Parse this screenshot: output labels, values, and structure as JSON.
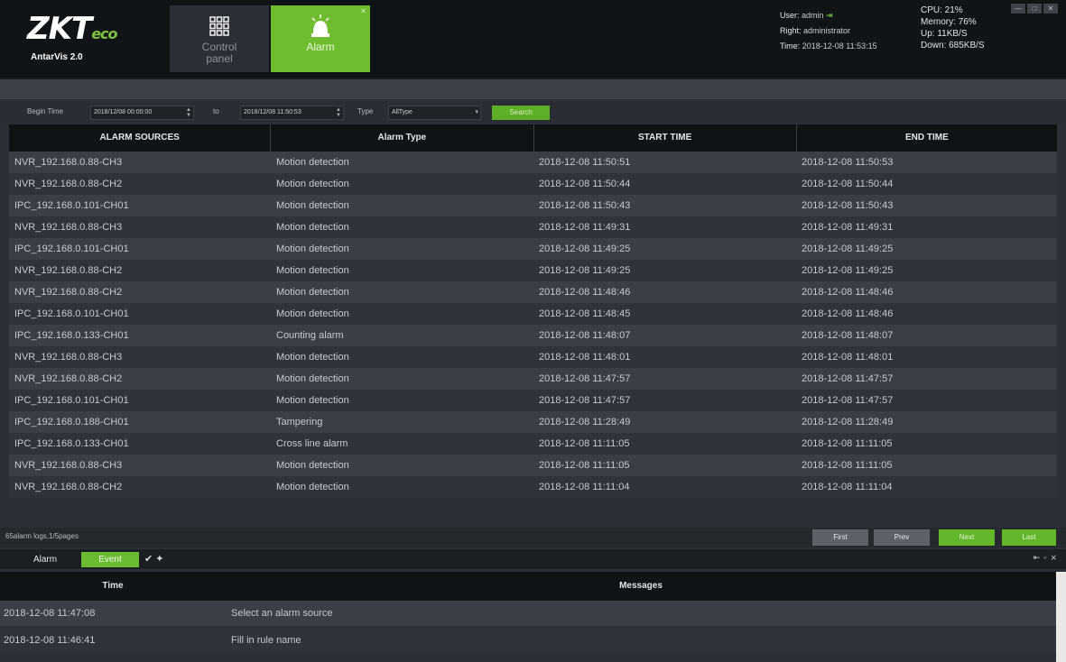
{
  "header": {
    "logo_text": "ZKT",
    "logo_suffix": "eco",
    "version": "AntarVis 2.0",
    "control_panel_label": "Control panel",
    "alarm_label": "Alarm",
    "user_label": "User:",
    "user_value": "admin",
    "right_label": "Right:",
    "right_value": "administrator",
    "time_label": "Time:",
    "time_value": "2018-12-08 11:53:15",
    "cpu": "CPU: 21%",
    "memory": "Memory: 76%",
    "up": "Up: 11KB/S",
    "down": "Down: 685KB/S"
  },
  "filter": {
    "begin_label": "Begin Time",
    "begin_value": "2018/12/08 00:00:00",
    "to_label": "to",
    "end_value": "2018/12/08 11:50:53",
    "type_label": "Type",
    "type_value": "AllType",
    "search_label": "Search"
  },
  "table": {
    "headers": [
      "ALARM SOURCES",
      "Alarm Type",
      "START TIME",
      "END TIME"
    ],
    "rows": [
      [
        "NVR_192.168.0.88-CH3",
        "Motion detection",
        "2018-12-08 11:50:51",
        "2018-12-08 11:50:53"
      ],
      [
        "NVR_192.168.0.88-CH2",
        "Motion detection",
        "2018-12-08 11:50:44",
        "2018-12-08 11:50:44"
      ],
      [
        "IPC_192.168.0.101-CH01",
        "Motion detection",
        "2018-12-08 11:50:43",
        "2018-12-08 11:50:43"
      ],
      [
        "NVR_192.168.0.88-CH3",
        "Motion detection",
        "2018-12-08 11:49:31",
        "2018-12-08 11:49:31"
      ],
      [
        "IPC_192.168.0.101-CH01",
        "Motion detection",
        "2018-12-08 11:49:25",
        "2018-12-08 11:49:25"
      ],
      [
        "NVR_192.168.0.88-CH2",
        "Motion detection",
        "2018-12-08 11:49:25",
        "2018-12-08 11:49:25"
      ],
      [
        "NVR_192.168.0.88-CH2",
        "Motion detection",
        "2018-12-08 11:48:46",
        "2018-12-08 11:48:46"
      ],
      [
        "IPC_192.168.0.101-CH01",
        "Motion detection",
        "2018-12-08 11:48:45",
        "2018-12-08 11:48:46"
      ],
      [
        "IPC_192.168.0.133-CH01",
        "Counting alarm",
        "2018-12-08 11:48:07",
        "2018-12-08 11:48:07"
      ],
      [
        "NVR_192.168.0.88-CH3",
        "Motion detection",
        "2018-12-08 11:48:01",
        "2018-12-08 11:48:01"
      ],
      [
        "NVR_192.168.0.88-CH2",
        "Motion detection",
        "2018-12-08 11:47:57",
        "2018-12-08 11:47:57"
      ],
      [
        "IPC_192.168.0.101-CH01",
        "Motion detection",
        "2018-12-08 11:47:57",
        "2018-12-08 11:47:57"
      ],
      [
        "IPC_192.168.0.188-CH01",
        "Tampering",
        "2018-12-08 11:28:49",
        "2018-12-08 11:28:49"
      ],
      [
        "IPC_192.168.0.133-CH01",
        "Cross line alarm",
        "2018-12-08 11:11:05",
        "2018-12-08 11:11:05"
      ],
      [
        "NVR_192.168.0.88-CH3",
        "Motion detection",
        "2018-12-08 11:11:05",
        "2018-12-08 11:11:05"
      ],
      [
        "NVR_192.168.0.88-CH2",
        "Motion detection",
        "2018-12-08 11:11:04",
        "2018-12-08 11:11:04"
      ]
    ]
  },
  "pager": {
    "info": "65alarm logs,1/5pages",
    "first": "First",
    "prev": "Prev",
    "next": "Next",
    "last": "Last"
  },
  "lower": {
    "tab_alarm": "Alarm",
    "tab_event": "Event",
    "headers": [
      "Time",
      "Messages"
    ],
    "rows": [
      [
        "2018-12-08 11:47:08",
        "Select an alarm source"
      ],
      [
        "2018-12-08 11:46:41",
        "Fill in rule name"
      ]
    ]
  }
}
